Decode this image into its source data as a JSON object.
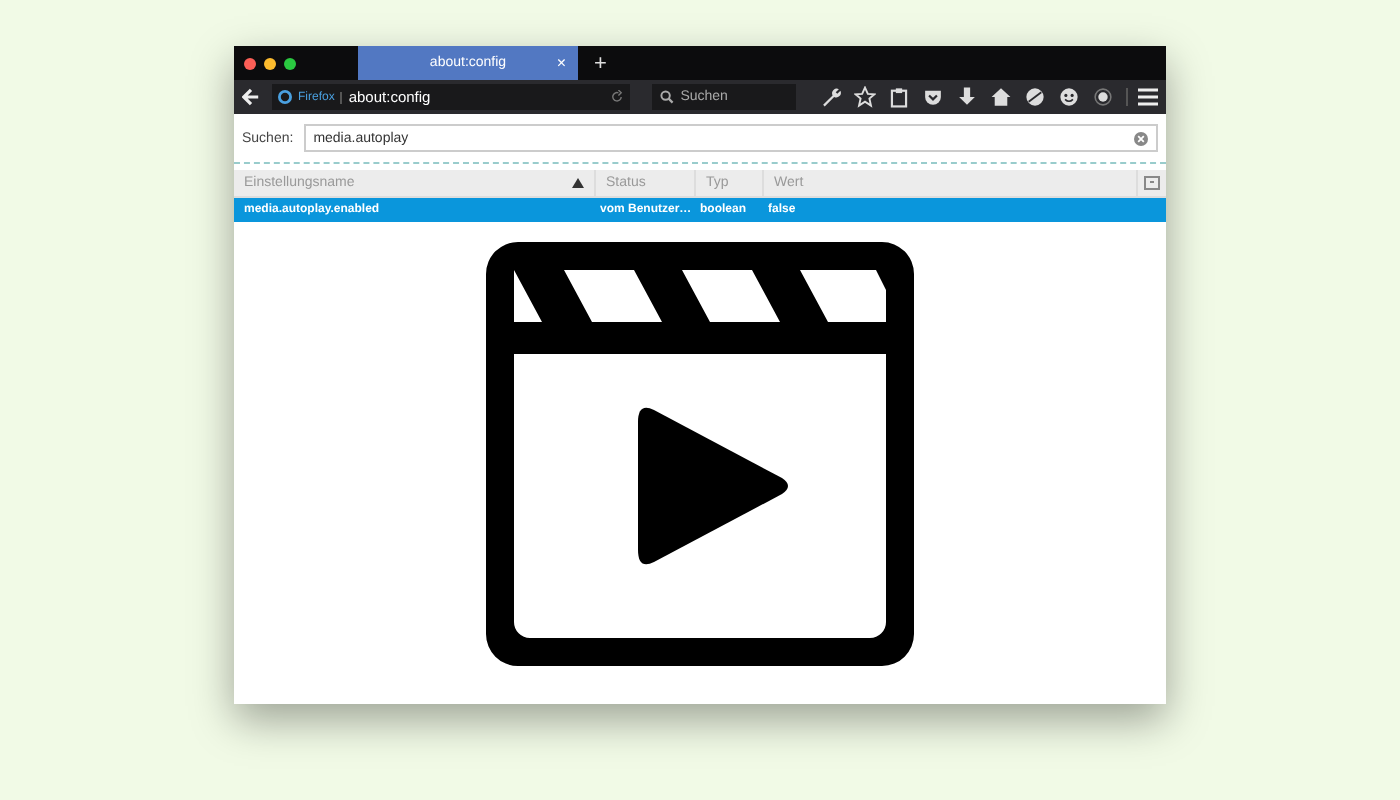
{
  "tabs": [
    {
      "title": "about:config",
      "selected": true,
      "close": "×"
    }
  ],
  "new_tab": "+",
  "navbar": {
    "brand": "Firefox",
    "url": "about:config",
    "search_placeholder": "Suchen"
  },
  "filter": {
    "label": "Suchen:",
    "value": "media.autoplay"
  },
  "table": {
    "columns": [
      "Einstellungsname",
      "Status",
      "Typ",
      "Wert"
    ],
    "rows": [
      {
        "cells": [
          "media.autoplay.enabled",
          "vom Benutzer…",
          "boolean",
          "false"
        ],
        "selected": true
      }
    ]
  }
}
